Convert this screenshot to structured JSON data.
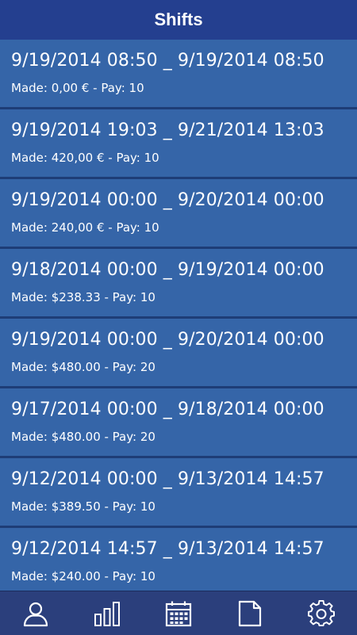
{
  "header": {
    "title": "Shifts"
  },
  "shifts": [
    {
      "range": "9/19/2014 08:50 _ 9/19/2014 08:50",
      "summary": "Made: 0,00 € - Pay: 10"
    },
    {
      "range": "9/19/2014 19:03 _ 9/21/2014 13:03",
      "summary": "Made: 420,00 € - Pay: 10"
    },
    {
      "range": "9/19/2014 00:00 _ 9/20/2014 00:00",
      "summary": "Made: 240,00 € - Pay: 10"
    },
    {
      "range": "9/18/2014 00:00 _ 9/19/2014 00:00",
      "summary": "Made: $238.33 - Pay: 10"
    },
    {
      "range": "9/19/2014 00:00 _ 9/20/2014 00:00",
      "summary": "Made: $480.00 - Pay: 20"
    },
    {
      "range": "9/17/2014 00:00 _ 9/18/2014 00:00",
      "summary": "Made: $480.00 - Pay: 20"
    },
    {
      "range": "9/12/2014 00:00 _ 9/13/2014 14:57",
      "summary": "Made: $389.50 - Pay: 10"
    },
    {
      "range": "9/12/2014 14:57 _ 9/13/2014 14:57",
      "summary": "Made: $240.00 - Pay: 10"
    }
  ],
  "tabbar": {
    "tabs": [
      {
        "icon": "person-icon"
      },
      {
        "icon": "bar-chart-icon"
      },
      {
        "icon": "calendar-icon"
      },
      {
        "icon": "document-icon"
      },
      {
        "icon": "gear-icon"
      }
    ]
  },
  "colors": {
    "header_bg": "#243f8f",
    "list_bg": "#3565a8",
    "divider": "#1e3d77",
    "tabbar_bg": "#2b3f7c",
    "text": "#ffffff"
  }
}
